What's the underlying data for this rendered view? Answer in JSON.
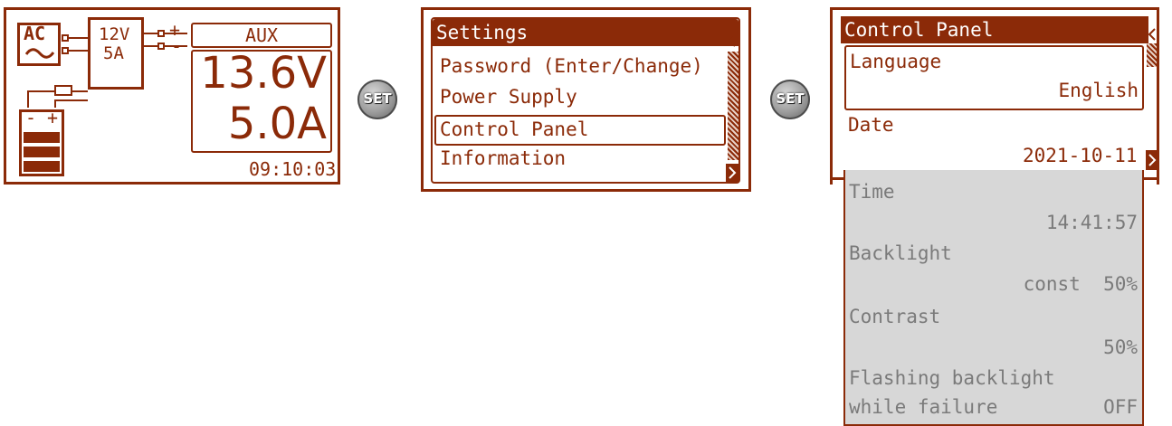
{
  "screen1": {
    "ac_label": "AC",
    "psu_voltage": "12V",
    "psu_current": "5A",
    "plus_sign": "+",
    "minus_sign": "-",
    "batt_minus": "-",
    "batt_plus": "+",
    "aux_title": "AUX",
    "voltage": "13.6V",
    "current": "5.0A",
    "clock": "09:10:03"
  },
  "set_buttons": [
    "SET",
    "SET"
  ],
  "screen2": {
    "title": "Settings",
    "items": [
      "Password (Enter/Change)",
      "Power Supply",
      "Control Panel",
      "Information"
    ],
    "selected_index": 2
  },
  "screen3": {
    "title": "Control Panel",
    "language_label": "Language",
    "language_value": "English",
    "date_label": "Date",
    "date_value": "2021-10-11"
  },
  "extended": {
    "time_label": "Time",
    "time_value": "14:41:57",
    "backlight_label": "Backlight",
    "backlight_value": "const  50%",
    "contrast_label": "Contrast",
    "contrast_value": "50%",
    "flash_label1": "Flashing backlight",
    "flash_label2": "while failure",
    "flash_value": "OFF"
  },
  "colors": {
    "accent": "#8b2a08",
    "grey_panel": "#d7d7d7",
    "grey_text": "#7a7a7a"
  }
}
